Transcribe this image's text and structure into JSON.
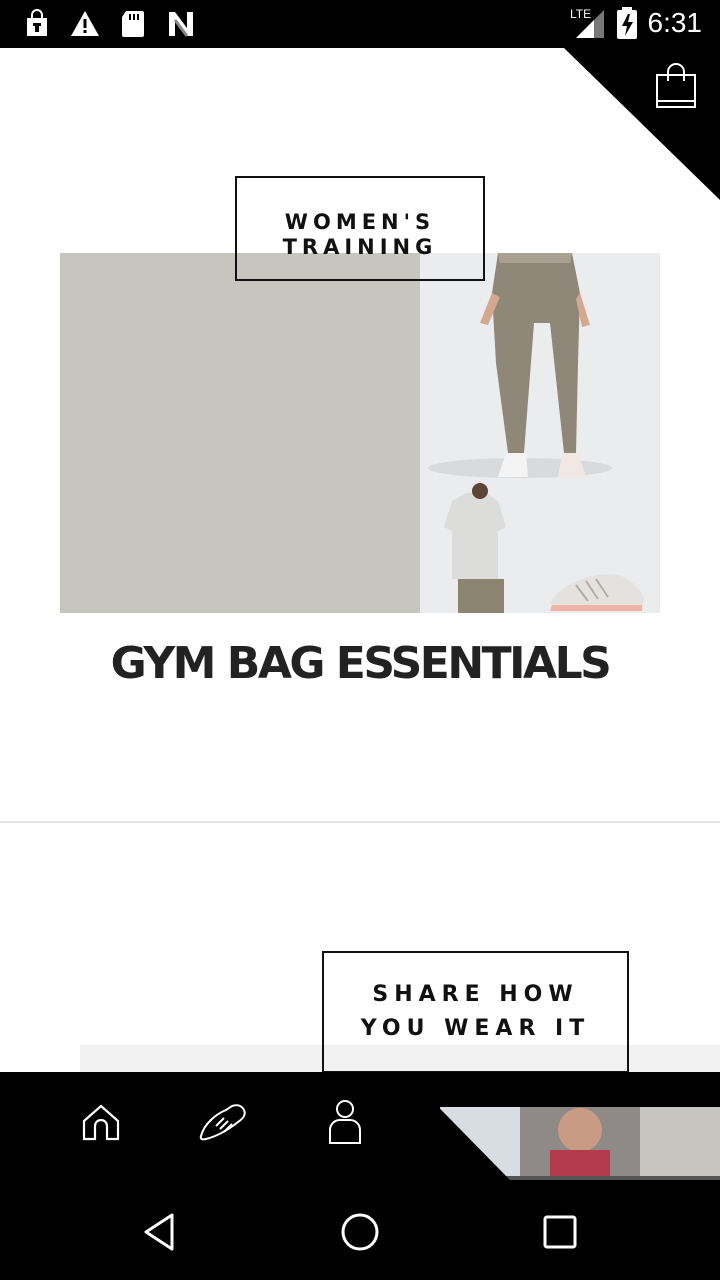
{
  "status_bar": {
    "time": "6:31",
    "network": "LTE",
    "icons": [
      "shopping-bag-notification-icon",
      "warning-icon",
      "sd-card-icon",
      "n-logo-icon"
    ]
  },
  "header": {
    "cart_icon": "shopping-bag-icon"
  },
  "cards": [
    {
      "tag_line1": "WOMEN'S",
      "tag_line2": "TRAINING",
      "title": "GYM BAG ESSENTIALS"
    },
    {
      "tag_line1": "SHARE HOW",
      "tag_line2": "YOU WEAR IT"
    }
  ],
  "tab_bar": {
    "tabs": [
      "home-icon",
      "shoe-icon",
      "profile-icon"
    ]
  },
  "nav_bar": {
    "buttons": [
      "back-icon",
      "home-circle-icon",
      "recents-icon"
    ]
  },
  "colors": {
    "accent": "#000000",
    "tile_gray": "#c6c6bf",
    "tile_light": "#ebecee"
  }
}
